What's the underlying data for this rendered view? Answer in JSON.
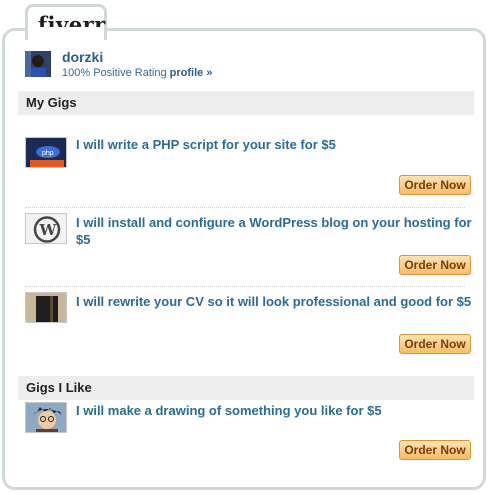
{
  "logo": "fiverr",
  "user": {
    "name": "dorzki",
    "rating_text": "100% Positive Rating",
    "profile_link": "profile »"
  },
  "sections": {
    "my_gigs": "My Gigs",
    "gigs_i_like": "Gigs I Like"
  },
  "gigs": [
    {
      "title": "I will write a PHP script for your site for $5",
      "order_label": "Order Now",
      "thumb": "php-image"
    },
    {
      "title": "I will install and configure a WordPress blog on your hosting for $5",
      "order_label": "Order Now",
      "thumb": "wordpress-logo"
    },
    {
      "title": "I will rewrite your CV so it will look professional and good for $5",
      "order_label": "Order Now",
      "thumb": "cv-folder"
    }
  ],
  "liked_gigs": [
    {
      "title": "I will make a drawing of something you like for $5",
      "order_label": "Order Now",
      "thumb": "drawing"
    }
  ],
  "colors": {
    "link": "#2a6c93",
    "border": "#d0d9d3",
    "button": "#f7bd6a"
  }
}
